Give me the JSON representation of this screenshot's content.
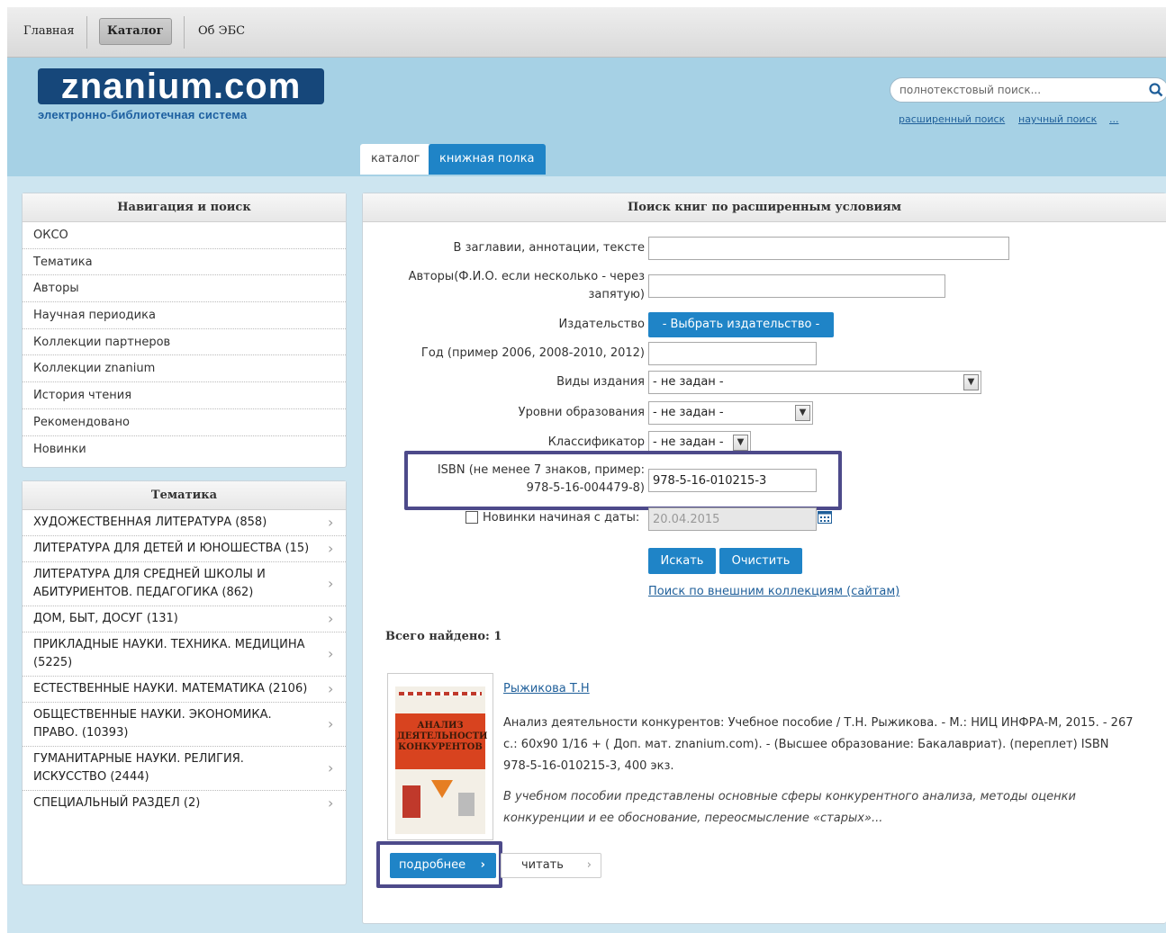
{
  "topnav": {
    "items": [
      "Главная",
      "Каталог",
      "Об ЭБС"
    ]
  },
  "header": {
    "logo": "znanium.com",
    "logo_subtitle": "электронно-библиотечная система",
    "search_placeholder": "полнотекстовый поиск...",
    "links": [
      "расширенный поиск",
      "научный поиск",
      "..."
    ],
    "tabs": [
      "каталог",
      "книжная полка"
    ]
  },
  "navigation": {
    "title": "Навигация и поиск",
    "items": [
      "ОКСО",
      "Тематика",
      "Авторы",
      "Научная периодика",
      "Коллекции партнеров",
      "Коллекции znanium",
      "История чтения",
      "Рекомендовано",
      "Новинки"
    ]
  },
  "themes": {
    "title": "Тематика",
    "items": [
      "ХУДОЖЕСТВЕННАЯ ЛИТЕРАТУРА (858)",
      "ЛИТЕРАТУРА ДЛЯ ДЕТЕЙ И ЮНОШЕСТВА (15)",
      "ЛИТЕРАТУРА ДЛЯ СРЕДНЕЙ ШКОЛЫ И АБИТУРИЕНТОВ. ПЕДАГОГИКА (862)",
      "ДОМ, БЫТ, ДОСУГ (131)",
      "ПРИКЛАДНЫЕ НАУКИ. ТЕХНИКА. МЕДИЦИНА (5225)",
      "ЕСТЕСТВЕННЫЕ НАУКИ. МАТЕМАТИКА (2106)",
      "ОБЩЕСТВЕННЫЕ НАУКИ. ЭКОНОМИКА. ПРАВО. (10393)",
      "ГУМАНИТАРНЫЕ НАУКИ. РЕЛИГИЯ. ИСКУССТВО (2444)",
      "СПЕЦИАЛЬНЫЙ РАЗДЕЛ (2)"
    ]
  },
  "search": {
    "title": "Поиск книг по расширенным условиям",
    "label_title": "В заглавии, аннотации, тексте",
    "label_authors": "Авторы(Ф.И.О. если несколько - через запятую)",
    "label_publisher": "Издательство",
    "publisher_button": "- Выбрать издательство -",
    "label_year": "Год (пример 2006, 2008-2010, 2012)",
    "label_type": "Виды издания",
    "type_value": "- не задан -",
    "label_level": "Уровни образования",
    "level_value": "- не задан -",
    "label_classifier": "Классификатор",
    "classifier_value": "- не задан -",
    "label_isbn": "ISBN (не менее 7 знаков, пример: 978-5-16-004479-8)",
    "isbn_value": "978-5-16-010215-3",
    "label_new": "Новинки начиная с даты:",
    "new_date": "20.04.2015",
    "search_button": "Искать",
    "clear_button": "Очистить",
    "external_link": "Поиск по внешним коллекциям (сайтам)"
  },
  "results": {
    "total": "Всего найдено: 1",
    "author": "Рыжикова Т.Н",
    "description": "Анализ деятельности конкурентов: Учебное пособие / Т.Н. Рыжикова. - М.: НИЦ ИНФРА-М, 2015. - 267 с.: 60x90 1/16 + ( Доп. мат. znanium.com). - (Высшее образование: Бакалавриат). (переплет) ISBN 978-5-16-010215-3, 400 экз.",
    "annotation": "В учебном пособии представлены основные сферы конкурентного анализа, методы оценки конкуренции и ее обоснование, переосмысление «старых»...",
    "cover_title": "АНАЛИЗ ДЕЯТЕЛЬНОСТИ КОНКУРЕНТОВ",
    "more_button": "подробнее",
    "read_button": "читать"
  },
  "colors": {
    "accent": "#1f84c7",
    "header_bg": "#a6d1e5",
    "logo_bg": "#16477a",
    "highlight": "#4d4a8a"
  }
}
